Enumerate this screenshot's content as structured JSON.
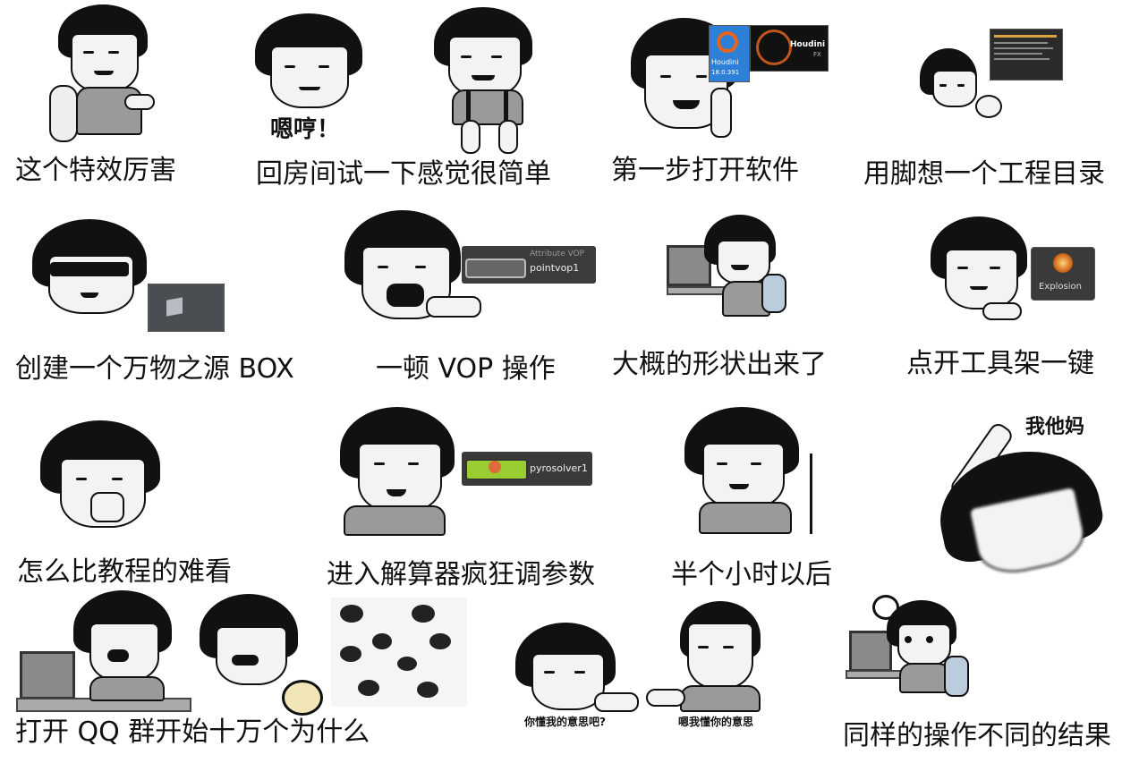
{
  "captions": {
    "c1": "这个特效厉害",
    "c2": "回房间试一下感觉很简单",
    "c3": "第一步打开软件",
    "c4": "用脚想一个工程目录",
    "c5": "创建一个万物之源 BOX",
    "c6": "一顿 VOP 操作",
    "c7": "大概的形状出来了",
    "c8": "点开工具架一键",
    "c9": "怎么比教程的难看",
    "c10": "进入解算器疯狂调参数",
    "c11": "半个小时以后",
    "c12": "打开 QQ 群开始十万个为什么",
    "c13": "同样的操作不同的结果"
  },
  "bubbles": {
    "hmph": "嗯哼！",
    "wtf": "我他妈",
    "know_me": "你懂我的意思吧?",
    "i_know": "嗯我懂你的意思"
  },
  "ui_text": {
    "houdini_icon_label": "Houdini",
    "houdini_version": "18.0.391",
    "houdini_logo": "Houdini",
    "houdini_fx": "FX",
    "attr_vop_type": "Attribute VOP",
    "attr_vop_name": "pointvop1",
    "explosion_label": "Explosion",
    "pyro_name": "pyrosolver1"
  },
  "colors": {
    "houdini_orange": "#e8641e",
    "houdini_blue": "#2e7fd6",
    "node_green": "#9acd32",
    "node_bg": "#3a3a3a"
  }
}
